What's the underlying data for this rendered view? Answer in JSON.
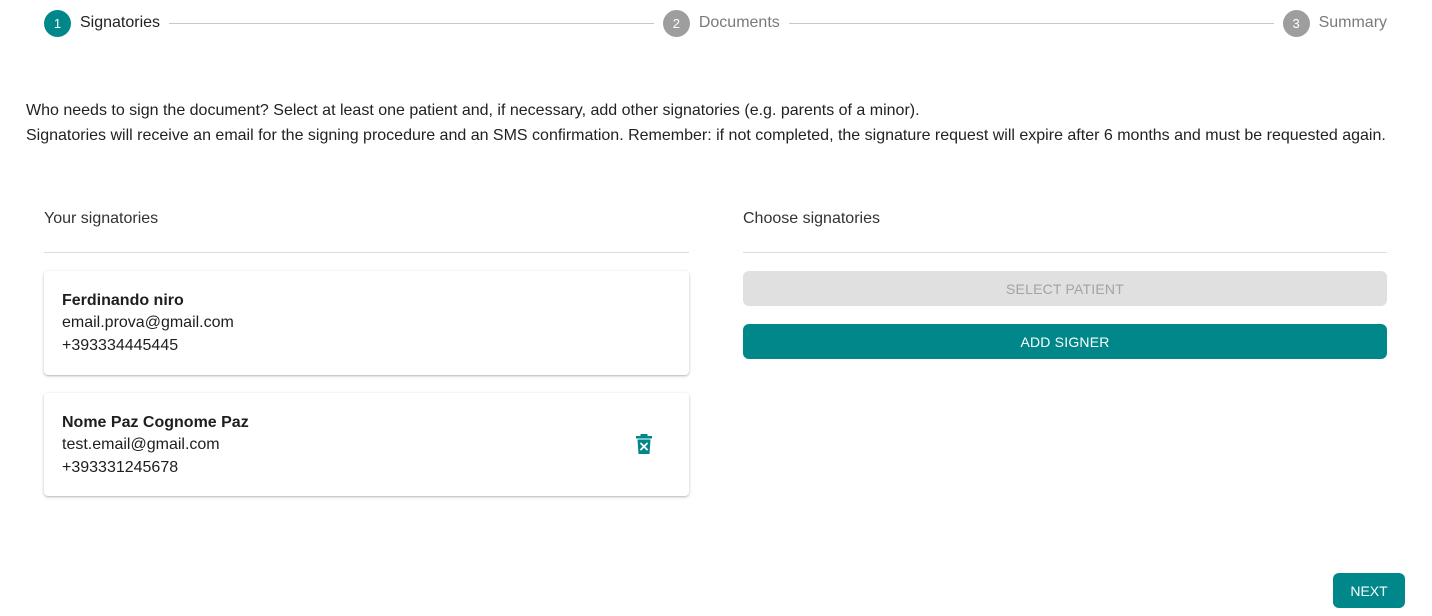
{
  "stepper": {
    "steps": [
      {
        "number": "1",
        "label": "Signatories",
        "state": "active"
      },
      {
        "number": "2",
        "label": "Documents",
        "state": "inactive"
      },
      {
        "number": "3",
        "label": "Summary",
        "state": "inactive"
      }
    ]
  },
  "intro": {
    "line1": "Who needs to sign the document? Select at least one patient and, if necessary, add other signatories (e.g. parents of a minor).",
    "line2": "Signatories will receive an email for the signing procedure and an SMS confirmation. Remember: if not completed, the signature request will expire after 6 months and must be requested again."
  },
  "your_signatories": {
    "title": "Your signatories",
    "items": [
      {
        "name": "Ferdinando niro",
        "email": "email.prova@gmail.com",
        "phone": "+393334445445",
        "deletable": false
      },
      {
        "name": "Nome Paz Cognome Paz",
        "email": "test.email@gmail.com",
        "phone": "+393331245678",
        "deletable": true
      }
    ]
  },
  "choose_signatories": {
    "title": "Choose signatories",
    "select_patient_label": "SELECT PATIENT",
    "add_signer_label": "ADD SIGNER"
  },
  "footer": {
    "next_label": "NEXT"
  },
  "colors": {
    "accent": "#00878a",
    "inactive_step": "#9e9e9e",
    "disabled_bg": "#e0e0e0"
  },
  "icons": {
    "delete": "trash-x-icon"
  }
}
